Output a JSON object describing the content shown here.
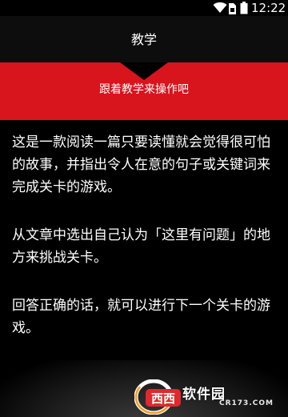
{
  "status_bar": {
    "time": "12:22",
    "icons": [
      "wifi-icon",
      "sim-icon",
      "battery-icon"
    ]
  },
  "header": {
    "title": "教学"
  },
  "banner": {
    "text": "跟着教学来操作吧",
    "color": "#d8141d"
  },
  "content": {
    "paragraphs": [
      "这是一款阅读一篇只要读懂就会觉得很可怕的故事，并指出令人在意的句子或关键词来完成关卡的游戏。",
      "从文章中选出自己认为「这里有问题」的地方来挑战关卡。",
      "回答正确的话，就可以进行下一个关卡的游戏。"
    ]
  },
  "watermark": {
    "logo_letters": "西西",
    "brand": "软件园",
    "domain": "CR173.COM",
    "colors": {
      "orange": "#f39a1e",
      "red": "#e0282d"
    }
  }
}
